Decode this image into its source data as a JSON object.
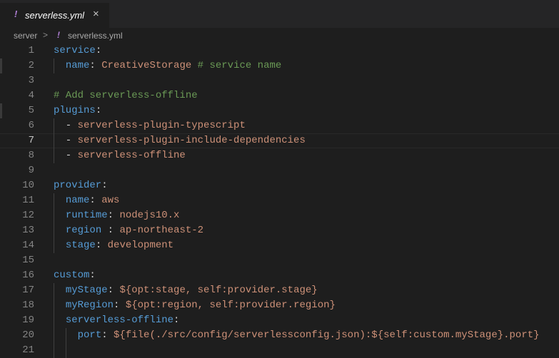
{
  "tab": {
    "filename": "serverless.yml",
    "icon": "!",
    "close": "×"
  },
  "breadcrumb": {
    "folder": "server",
    "sep": ">",
    "icon": "!",
    "file": "serverless.yml"
  },
  "colors": {
    "key": "#569cd6",
    "value": "#ce9178",
    "comment": "#6a9955",
    "punct": "#d4d4d4",
    "yaml_icon": "#b180d7"
  },
  "lines": [
    {
      "n": "1",
      "tokens": [
        [
          "k",
          "service"
        ],
        [
          "p",
          ":"
        ]
      ]
    },
    {
      "n": "2",
      "tokens": [
        [
          "p",
          "  "
        ],
        [
          "k",
          "name"
        ],
        [
          "p",
          ": "
        ],
        [
          "v",
          "CreativeStorage"
        ],
        [
          "p",
          " "
        ],
        [
          "c",
          "# service name"
        ]
      ]
    },
    {
      "n": "3",
      "tokens": []
    },
    {
      "n": "4",
      "tokens": [
        [
          "c",
          "# Add serverless-offline"
        ]
      ]
    },
    {
      "n": "5",
      "tokens": [
        [
          "k",
          "plugins"
        ],
        [
          "p",
          ":"
        ]
      ]
    },
    {
      "n": "6",
      "tokens": [
        [
          "p",
          "  - "
        ],
        [
          "v",
          "serverless-plugin-typescript"
        ]
      ]
    },
    {
      "n": "7",
      "tokens": [
        [
          "p",
          "  - "
        ],
        [
          "v",
          "serverless-plugin-include-dependencies"
        ]
      ]
    },
    {
      "n": "8",
      "tokens": [
        [
          "p",
          "  - "
        ],
        [
          "v",
          "serverless-offline"
        ]
      ]
    },
    {
      "n": "9",
      "tokens": []
    },
    {
      "n": "10",
      "tokens": [
        [
          "k",
          "provider"
        ],
        [
          "p",
          ":"
        ]
      ]
    },
    {
      "n": "11",
      "tokens": [
        [
          "p",
          "  "
        ],
        [
          "k",
          "name"
        ],
        [
          "p",
          ": "
        ],
        [
          "v",
          "aws"
        ]
      ]
    },
    {
      "n": "12",
      "tokens": [
        [
          "p",
          "  "
        ],
        [
          "k",
          "runtime"
        ],
        [
          "p",
          ": "
        ],
        [
          "v",
          "nodejs10.x"
        ]
      ]
    },
    {
      "n": "13",
      "tokens": [
        [
          "p",
          "  "
        ],
        [
          "k",
          "region"
        ],
        [
          "p",
          " : "
        ],
        [
          "v",
          "ap-northeast-2"
        ]
      ]
    },
    {
      "n": "14",
      "tokens": [
        [
          "p",
          "  "
        ],
        [
          "k",
          "stage"
        ],
        [
          "p",
          ": "
        ],
        [
          "v",
          "development"
        ]
      ]
    },
    {
      "n": "15",
      "tokens": []
    },
    {
      "n": "16",
      "tokens": [
        [
          "k",
          "custom"
        ],
        [
          "p",
          ":"
        ]
      ]
    },
    {
      "n": "17",
      "tokens": [
        [
          "p",
          "  "
        ],
        [
          "k",
          "myStage"
        ],
        [
          "p",
          ": "
        ],
        [
          "v",
          "${opt:stage, self:provider.stage}"
        ]
      ]
    },
    {
      "n": "18",
      "tokens": [
        [
          "p",
          "  "
        ],
        [
          "k",
          "myRegion"
        ],
        [
          "p",
          ": "
        ],
        [
          "v",
          "${opt:region, self:provider.region}"
        ]
      ]
    },
    {
      "n": "19",
      "tokens": [
        [
          "p",
          "  "
        ],
        [
          "k",
          "serverless-offline"
        ],
        [
          "p",
          ":"
        ]
      ]
    },
    {
      "n": "20",
      "tokens": [
        [
          "p",
          "    "
        ],
        [
          "k",
          "port"
        ],
        [
          "p",
          ": "
        ],
        [
          "v",
          "${file(./src/config/serverlessconfig.json):${self:custom.myStage}.port}"
        ]
      ]
    },
    {
      "n": "21",
      "tokens": []
    }
  ],
  "cursor_line": "7"
}
